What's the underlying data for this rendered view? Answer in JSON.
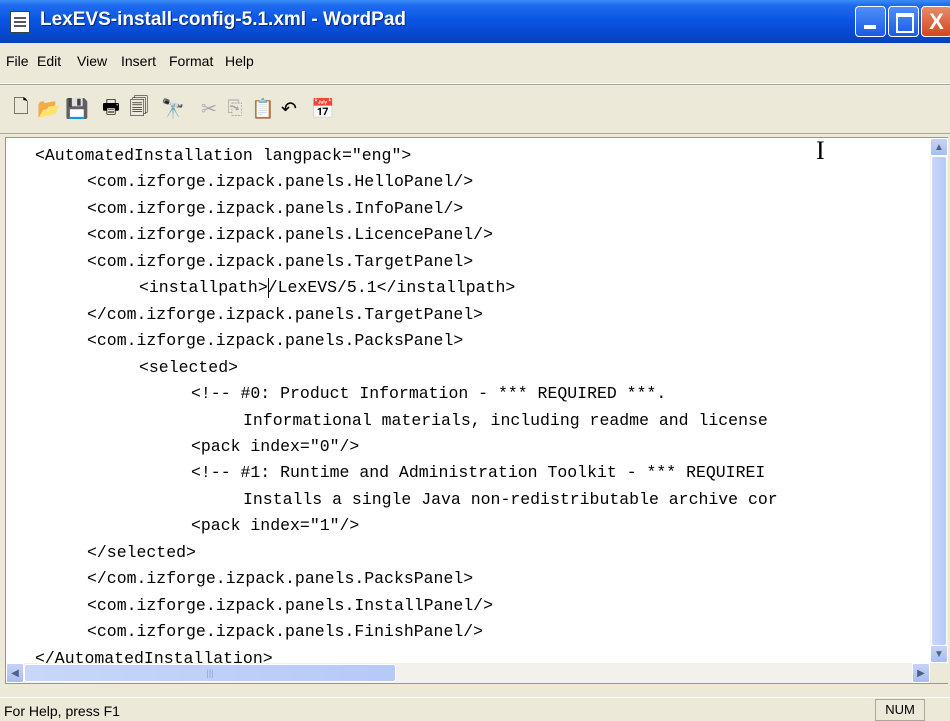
{
  "window": {
    "title": "LexEVS-install-config-5.1.xml - WordPad",
    "controls": {
      "minimize_icon": "minimize-icon",
      "maximize_icon": "maximize-icon",
      "close_symbol": "X"
    }
  },
  "menu": {
    "items": [
      {
        "label": "File"
      },
      {
        "label": "Edit"
      },
      {
        "label": "View"
      },
      {
        "label": "Insert"
      },
      {
        "label": "Format"
      },
      {
        "label": "Help"
      }
    ]
  },
  "toolbar": {
    "buttons": [
      {
        "name": "new-document-icon",
        "glyph": "🗋",
        "enabled": true
      },
      {
        "name": "open-folder-icon",
        "glyph": "📂",
        "enabled": true
      },
      {
        "name": "save-icon",
        "glyph": "💾",
        "enabled": true
      },
      {
        "name": "print-icon",
        "glyph": "🖶",
        "enabled": true
      },
      {
        "name": "print-preview-icon",
        "glyph": "🗐",
        "enabled": true
      },
      {
        "name": "find-icon",
        "glyph": "🔭",
        "enabled": true
      },
      {
        "name": "cut-icon",
        "glyph": "✂",
        "enabled": false
      },
      {
        "name": "copy-icon",
        "glyph": "⎘",
        "enabled": false
      },
      {
        "name": "paste-icon",
        "glyph": "📋",
        "enabled": true
      },
      {
        "name": "undo-icon",
        "glyph": "↶",
        "enabled": true
      },
      {
        "name": "insert-datetime-icon",
        "glyph": "📅",
        "enabled": true
      }
    ]
  },
  "document": {
    "lines": [
      {
        "indent": 0,
        "text": "<AutomatedInstallation langpack=\"eng\">"
      },
      {
        "indent": 1,
        "text": "<com.izforge.izpack.panels.HelloPanel/>"
      },
      {
        "indent": 1,
        "text": "<com.izforge.izpack.panels.InfoPanel/>"
      },
      {
        "indent": 1,
        "text": "<com.izforge.izpack.panels.LicencePanel/>"
      },
      {
        "indent": 1,
        "text": "<com.izforge.izpack.panels.TargetPanel>"
      },
      {
        "indent": 2,
        "text": "<installpath>/LexEVS/5.1</installpath>"
      },
      {
        "indent": 1,
        "text": "</com.izforge.izpack.panels.TargetPanel>"
      },
      {
        "indent": 1,
        "text": "<com.izforge.izpack.panels.PacksPanel>"
      },
      {
        "indent": 2,
        "text": "<selected>"
      },
      {
        "indent": 3,
        "text": "<!-- #0: Product Information - *** REQUIRED ***."
      },
      {
        "indent": 4,
        "text": "Informational materials, including readme and license"
      },
      {
        "indent": 3,
        "text": "<pack index=\"0\"/>"
      },
      {
        "indent": 3,
        "text": "<!-- #1: Runtime and Administration Toolkit - *** REQUIREI"
      },
      {
        "indent": 4,
        "text": "Installs a single Java non-redistributable archive cor"
      },
      {
        "indent": 3,
        "text": "<pack index=\"1\"/>"
      },
      {
        "indent": 1,
        "text": "</selected>"
      },
      {
        "indent": 1,
        "text": "</com.izforge.izpack.panels.PacksPanel>"
      },
      {
        "indent": 1,
        "text": "<com.izforge.izpack.panels.InstallPanel/>"
      },
      {
        "indent": 1,
        "text": "<com.izforge.izpack.panels.FinishPanel/>"
      },
      {
        "indent": 0,
        "text": "</AutomatedInstallation>"
      }
    ],
    "caret": {
      "line": 5,
      "column": 13
    }
  },
  "scrollbars": {
    "up_arrow": "▲",
    "down_arrow": "▼",
    "left_arrow": "◀",
    "right_arrow": "▶",
    "grip": "|||"
  },
  "status": {
    "help_text": "For Help, press F1",
    "num_indicator": "NUM"
  }
}
